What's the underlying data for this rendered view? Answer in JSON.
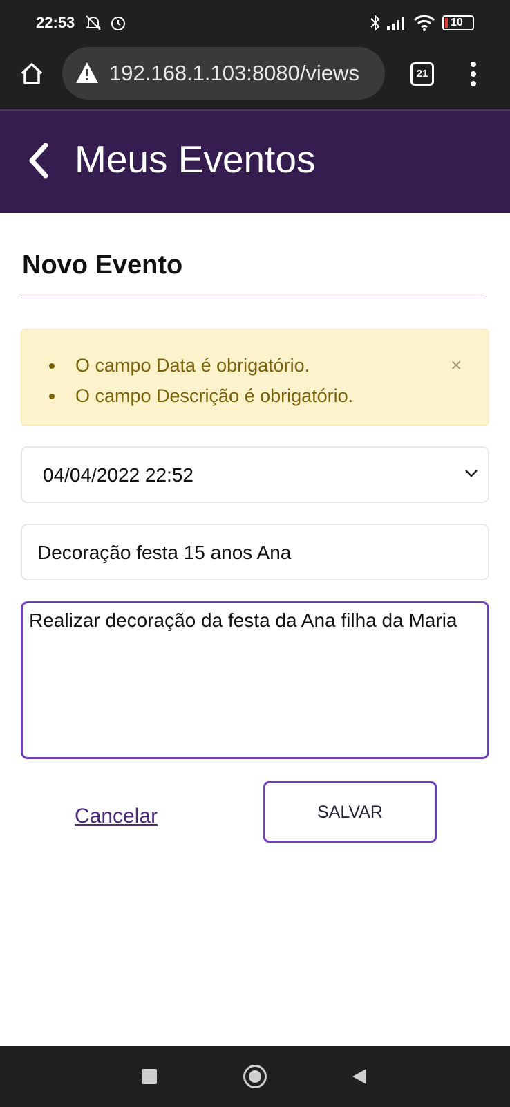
{
  "status_bar": {
    "time": "22:53",
    "battery": "10",
    "icons": [
      "bell-off-icon",
      "alarm-icon",
      "bluetooth-icon",
      "signal-icon",
      "wifi-icon",
      "battery-icon"
    ]
  },
  "browser": {
    "url": "192.168.1.103:8080/views",
    "tab_count": "21",
    "icons": [
      "home-icon",
      "warning-icon",
      "tabs-icon",
      "menu-dots-icon"
    ]
  },
  "header": {
    "title": "Meus Eventos",
    "background": "#351d4f"
  },
  "form": {
    "title": "Novo Evento",
    "alert": {
      "messages": [
        "O campo Data é obrigatório.",
        "O campo Descrição é obrigatório."
      ],
      "close_label": "×"
    },
    "date_value": "04/04/2022 22:52",
    "title_value": "Decoração festa 15 anos Ana",
    "description_value": "Realizar decoração da festa da Ana filha da Maria",
    "cancel_label": "Cancelar",
    "save_label": "SALVAR"
  },
  "colors": {
    "accent": "#6f3fc0",
    "alert_bg": "#fcf2cc",
    "alert_text": "#7a6209"
  }
}
